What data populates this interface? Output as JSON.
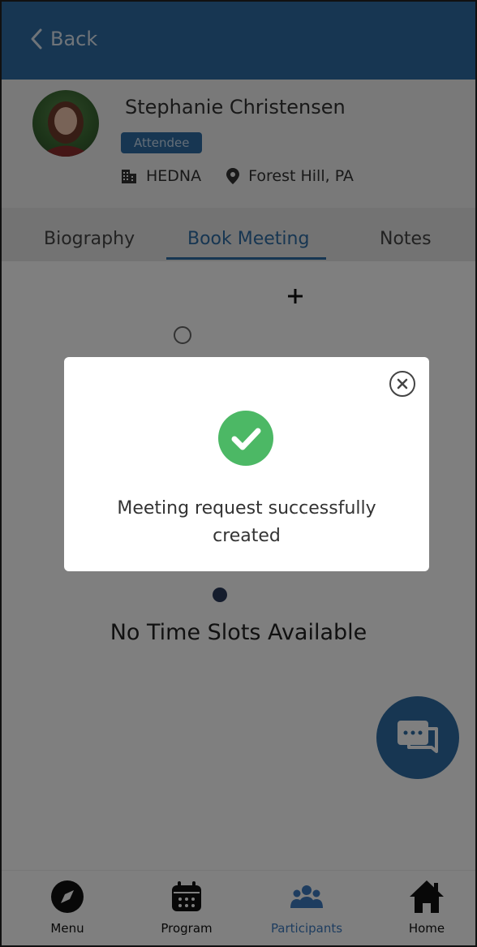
{
  "header": {
    "back_label": "Back"
  },
  "profile": {
    "name": "Stephanie Christensen",
    "role_badge": "Attendee",
    "organization": "HEDNA",
    "location": "Forest Hill, PA"
  },
  "tabs": [
    {
      "label": "Biography"
    },
    {
      "label": "Book Meeting"
    },
    {
      "label": "Notes"
    }
  ],
  "content": {
    "no_slots_text": "No Time Slots Available"
  },
  "modal": {
    "message": "Meeting request successfully created"
  },
  "bottom_nav": [
    {
      "label": "Menu"
    },
    {
      "label": "Program"
    },
    {
      "label": "Participants"
    },
    {
      "label": "Home"
    }
  ],
  "colors": {
    "primary": "#2e6da4",
    "success": "#4cb865"
  }
}
